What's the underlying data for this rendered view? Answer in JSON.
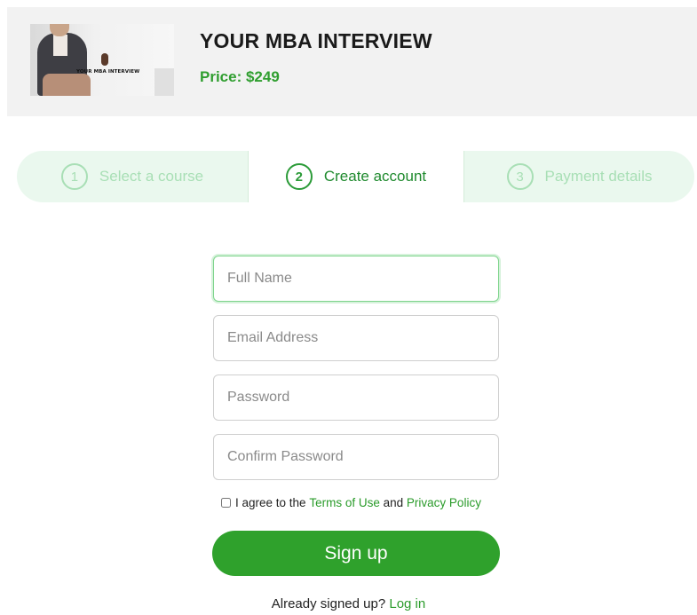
{
  "course": {
    "title": "YOUR MBA INTERVIEW",
    "price": "Price: $249",
    "thumbnail_logo_text": "YOUR MBA INTERVIEW"
  },
  "steps": [
    {
      "number": "1",
      "label": "Select a course",
      "state": "inactive"
    },
    {
      "number": "2",
      "label": "Create account",
      "state": "active"
    },
    {
      "number": "3",
      "label": "Payment details",
      "state": "inactive"
    }
  ],
  "form": {
    "full_name": {
      "placeholder": "Full Name",
      "value": ""
    },
    "email": {
      "placeholder": "Email Address",
      "value": ""
    },
    "password": {
      "placeholder": "Password",
      "value": ""
    },
    "confirm_password": {
      "placeholder": "Confirm Password",
      "value": ""
    },
    "agree": {
      "checked": false,
      "prefix": "I agree to the",
      "terms_link": "Terms of Use",
      "conjunction": "and",
      "privacy_link": "Privacy Policy"
    },
    "submit_label": "Sign up"
  },
  "login": {
    "prompt": "Already signed up?",
    "link": "Log in"
  },
  "colors": {
    "accent_green": "#2fa12c",
    "link_green": "#2a9b2a",
    "steps_background": "#eaf8ee",
    "header_background": "#f2f2f2"
  }
}
